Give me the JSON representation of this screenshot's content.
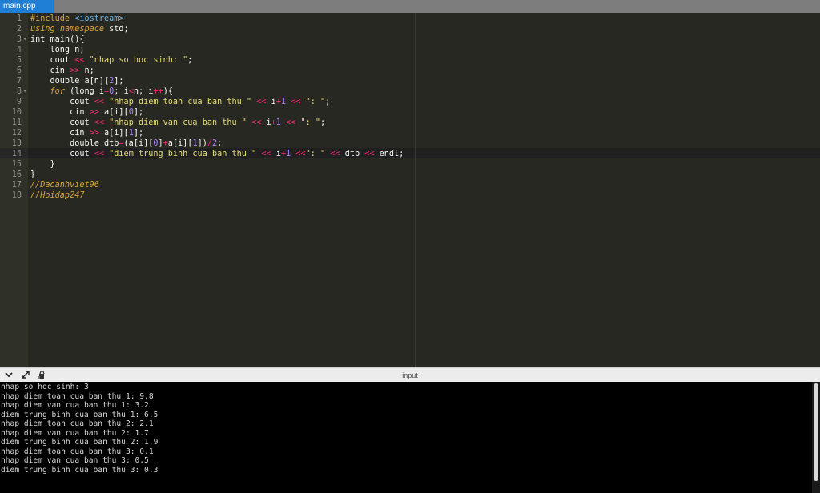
{
  "tab": {
    "label": "main.cpp"
  },
  "editor": {
    "line_numbers": [
      "1",
      "2",
      "3",
      "4",
      "5",
      "6",
      "7",
      "8",
      "9",
      "10",
      "11",
      "12",
      "13",
      "14",
      "15",
      "16",
      "17",
      "18"
    ],
    "fold_markers": {
      "3": "▾",
      "8": "▾"
    },
    "lines": [
      "#include <iostream>",
      "using namespace std;",
      "int main(){",
      "    long n;",
      "    cout << \"nhap so hoc sinh: \";",
      "    cin >> n;",
      "    double a[n][2];",
      "    for (long i=0; i<n; i++){",
      "        cout << \"nhap diem toan cua ban thu \" << i+1 << \": \";",
      "        cin >> a[i][0];",
      "        cout << \"nhap diem van cua ban thu \" << i+1 << \": \";",
      "        cin >> a[i][1];",
      "        double dtb=(a[i][0]+a[i][1])/2;",
      "        cout << \"diem trung binh cua ban thu \" << i+1 <<\": \" << dtb << endl;",
      "    }",
      "}",
      "//Daoanhviet96",
      "//Hoidap247"
    ]
  },
  "panel": {
    "title": "input",
    "icons": [
      "chevron-down-icon",
      "expand-icon",
      "clear-icon"
    ]
  },
  "console": {
    "lines": [
      "nhap so hoc sinh: 3",
      "nhap diem toan cua ban thu 1: 9.8",
      "nhap diem van cua ban thu 1: 3.2",
      "diem trung binh cua ban thu 1: 6.5",
      "nhap diem toan cua ban thu 2: 2.1",
      "nhap diem van cua ban thu 2: 1.7",
      "diem trung binh cua ban thu 2: 1.9",
      "nhap diem toan cua ban thu 3: 0.1",
      "nhap diem van cua ban thu 3: 0.5",
      "diem trung binh cua ban thu 3: 0.3"
    ]
  },
  "colors": {
    "tab_accent": "#1f7fd6",
    "editor_bg": "#272822",
    "console_bg": "#000000"
  }
}
